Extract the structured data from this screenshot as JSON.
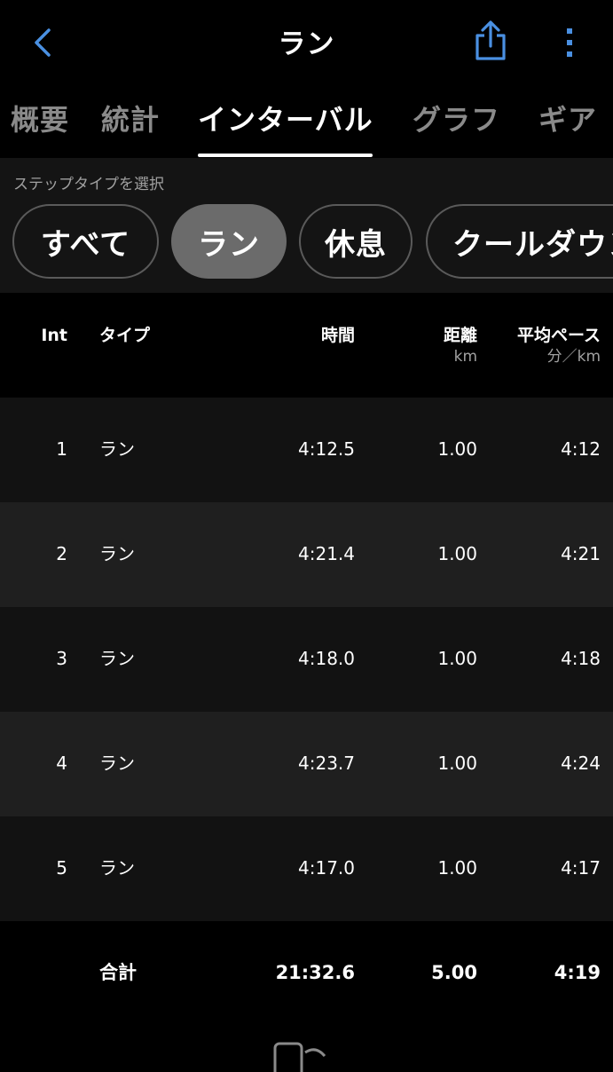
{
  "header": {
    "title": "ラン"
  },
  "tabs": [
    {
      "label": "概要"
    },
    {
      "label": "統計"
    },
    {
      "label": "インターバル"
    },
    {
      "label": "グラフ"
    },
    {
      "label": "ギア"
    }
  ],
  "filter": {
    "label": "ステップタイプを選択",
    "chips": [
      {
        "label": "すべて"
      },
      {
        "label": "ラン"
      },
      {
        "label": "休息"
      },
      {
        "label": "クールダウン"
      }
    ]
  },
  "table": {
    "headers": {
      "int": "Int",
      "type": "タイプ",
      "time": "時間",
      "distance": "距離",
      "distance_unit": "km",
      "pace": "平均ペース",
      "pace_unit": "分／km"
    },
    "rows": [
      {
        "int": "1",
        "type": "ラン",
        "time": "4:12.5",
        "distance": "1.00",
        "pace": "4:12"
      },
      {
        "int": "2",
        "type": "ラン",
        "time": "4:21.4",
        "distance": "1.00",
        "pace": "4:21"
      },
      {
        "int": "3",
        "type": "ラン",
        "time": "4:18.0",
        "distance": "1.00",
        "pace": "4:18"
      },
      {
        "int": "4",
        "type": "ラン",
        "time": "4:23.7",
        "distance": "1.00",
        "pace": "4:24"
      },
      {
        "int": "5",
        "type": "ラン",
        "time": "4:17.0",
        "distance": "1.00",
        "pace": "4:17"
      }
    ],
    "total": {
      "label": "合計",
      "time": "21:32.6",
      "distance": "5.00",
      "pace": "4:19"
    }
  },
  "colors": {
    "accent": "#4a90e2",
    "background": "#000000",
    "row_alt": "#1f1f1f",
    "chip_selected": "#6b6b6b"
  }
}
